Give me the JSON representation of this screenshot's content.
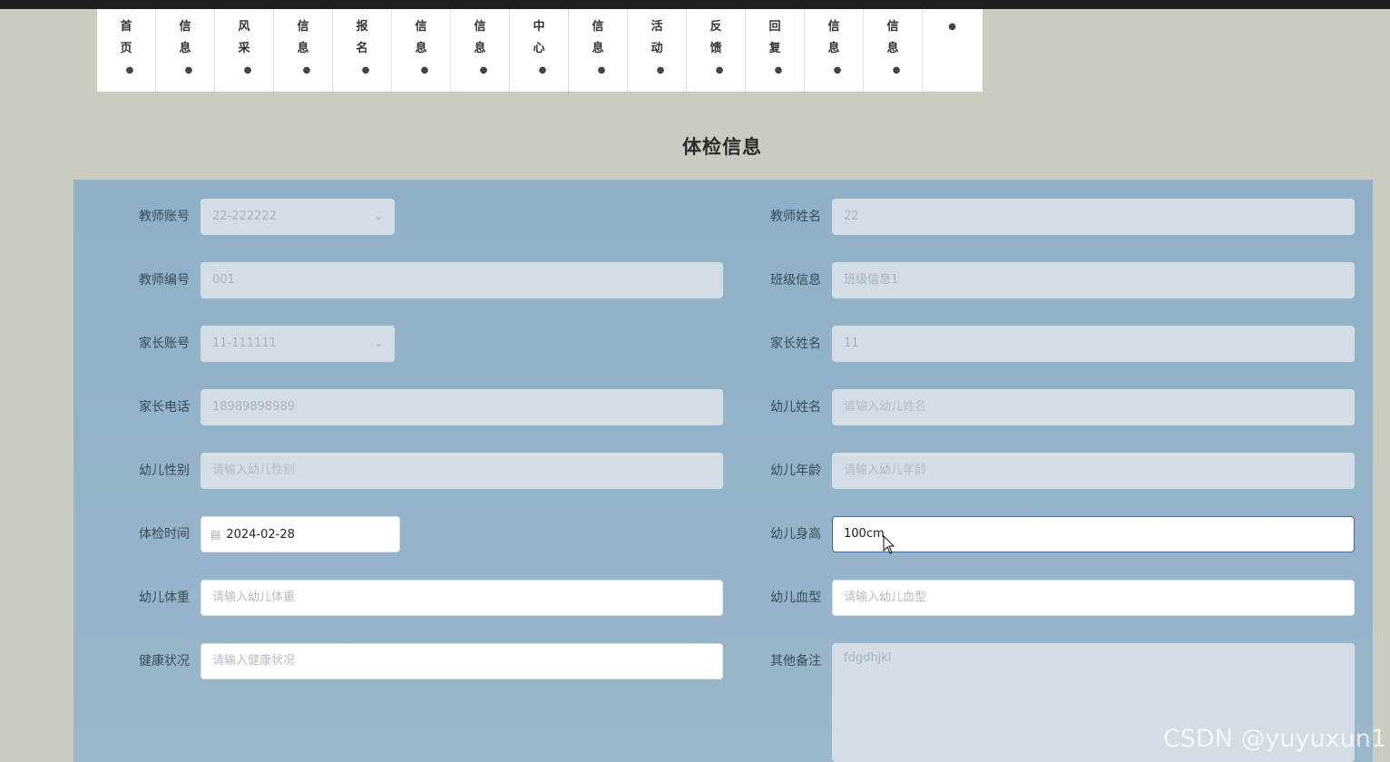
{
  "nav": {
    "items": [
      {
        "lines": [
          "首",
          "页"
        ],
        "icon": "●"
      },
      {
        "lines": [
          "信",
          "息"
        ],
        "icon": "●"
      },
      {
        "lines": [
          "风",
          "采"
        ],
        "icon": "●"
      },
      {
        "lines": [
          "信",
          "息"
        ],
        "icon": "●"
      },
      {
        "lines": [
          "报",
          "名"
        ],
        "icon": "●"
      },
      {
        "lines": [
          "信",
          "息"
        ],
        "icon": "●"
      },
      {
        "lines": [
          "信",
          "息"
        ],
        "icon": "●"
      },
      {
        "lines": [
          "中",
          "心"
        ],
        "icon": "●"
      },
      {
        "lines": [
          "信",
          "息"
        ],
        "icon": "●"
      },
      {
        "lines": [
          "活",
          "动"
        ],
        "icon": "●"
      },
      {
        "lines": [
          "反",
          "馈"
        ],
        "icon": "●"
      },
      {
        "lines": [
          "回",
          "复"
        ],
        "icon": "●"
      },
      {
        "lines": [
          "信",
          "息"
        ],
        "icon": "●"
      },
      {
        "lines": [
          "信",
          "息"
        ],
        "icon": "●"
      },
      {
        "lines": [],
        "icon": "●"
      }
    ]
  },
  "page_title": "体检信息",
  "form": {
    "teacher_account": {
      "label": "教师账号",
      "value": "22-222222"
    },
    "teacher_name": {
      "label": "教师姓名",
      "value": "22"
    },
    "teacher_no": {
      "label": "教师编号",
      "value": "001"
    },
    "class_info": {
      "label": "班级信息",
      "value": "班级信息1"
    },
    "parent_account": {
      "label": "家长账号",
      "value": "11-111111"
    },
    "parent_name": {
      "label": "家长姓名",
      "value": "11"
    },
    "parent_phone": {
      "label": "家长电话",
      "value": "18989898989"
    },
    "child_name": {
      "label": "幼儿姓名",
      "placeholder": "请输入幼儿姓名"
    },
    "child_gender": {
      "label": "幼儿性别",
      "placeholder": "请输入幼儿性别"
    },
    "child_age": {
      "label": "幼儿年龄",
      "placeholder": "请输入幼儿年龄"
    },
    "exam_time": {
      "label": "体检时间",
      "value": "2024-02-28"
    },
    "child_height": {
      "label": "幼儿身高",
      "value": "100cm"
    },
    "child_weight": {
      "label": "幼儿体重",
      "placeholder": "请输入幼儿体重"
    },
    "child_blood": {
      "label": "幼儿血型",
      "placeholder": "请输入幼儿血型"
    },
    "health_status": {
      "label": "健康状况",
      "placeholder": "请输入健康状况"
    },
    "other_notes": {
      "label": "其他备注",
      "value": "fdgdhjkl"
    }
  },
  "watermark": "CSDN @yuyuxun1",
  "colors": {
    "page_bg": "#cbcbbf",
    "panel_bg": "#93b2c7",
    "focus_border": "#3a6b96"
  }
}
